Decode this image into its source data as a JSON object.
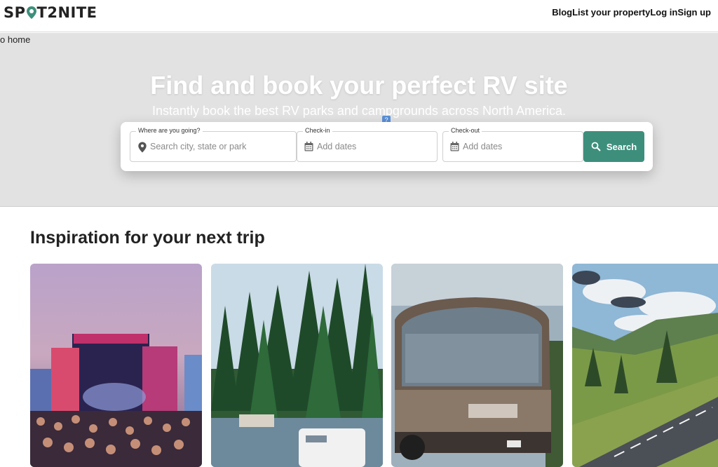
{
  "brand": {
    "logo_text_a": "SP",
    "logo_text_b": "T2NITE"
  },
  "nav": {
    "items": [
      "Blog",
      "List your property",
      "Log in",
      "Sign up"
    ]
  },
  "skip_link": "o home",
  "hero": {
    "title": "Find and book your perfect RV site",
    "subtitle": "Instantly book the best RV parks and campgrounds across North America.",
    "help_badge": "?"
  },
  "search": {
    "where_label": "Where are you going?",
    "where_placeholder": "Search city, state or park",
    "checkin_label": "Check-in",
    "checkin_placeholder": "Add dates",
    "checkout_label": "Check-out",
    "checkout_placeholder": "Add dates",
    "button_label": "Search"
  },
  "inspiration": {
    "title": "Inspiration for your next trip"
  },
  "colors": {
    "brand_green": "#3d8f7c",
    "hero_bg": "#e2e2e2"
  },
  "icons": [
    "location-pin-icon",
    "calendar-icon",
    "search-icon"
  ]
}
